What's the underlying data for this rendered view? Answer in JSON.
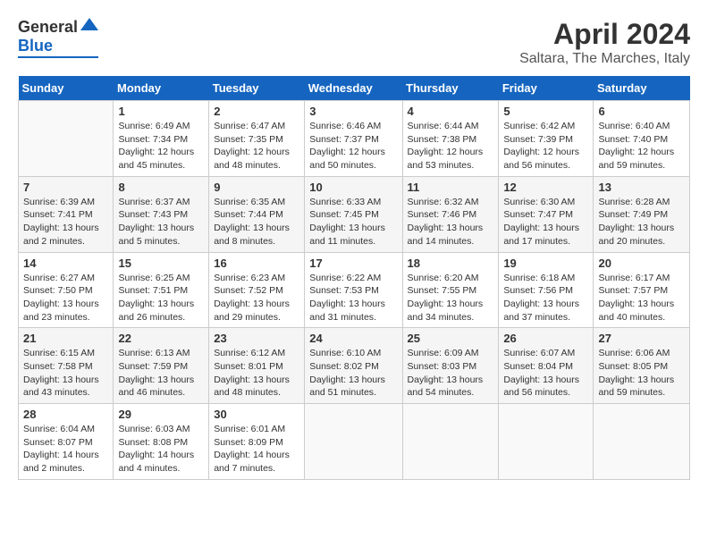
{
  "header": {
    "logo_general": "General",
    "logo_blue": "Blue",
    "title": "April 2024",
    "subtitle": "Saltara, The Marches, Italy"
  },
  "calendar": {
    "days_of_week": [
      "Sunday",
      "Monday",
      "Tuesday",
      "Wednesday",
      "Thursday",
      "Friday",
      "Saturday"
    ],
    "weeks": [
      [
        {
          "day": "",
          "info": ""
        },
        {
          "day": "1",
          "info": "Sunrise: 6:49 AM\nSunset: 7:34 PM\nDaylight: 12 hours\nand 45 minutes."
        },
        {
          "day": "2",
          "info": "Sunrise: 6:47 AM\nSunset: 7:35 PM\nDaylight: 12 hours\nand 48 minutes."
        },
        {
          "day": "3",
          "info": "Sunrise: 6:46 AM\nSunset: 7:37 PM\nDaylight: 12 hours\nand 50 minutes."
        },
        {
          "day": "4",
          "info": "Sunrise: 6:44 AM\nSunset: 7:38 PM\nDaylight: 12 hours\nand 53 minutes."
        },
        {
          "day": "5",
          "info": "Sunrise: 6:42 AM\nSunset: 7:39 PM\nDaylight: 12 hours\nand 56 minutes."
        },
        {
          "day": "6",
          "info": "Sunrise: 6:40 AM\nSunset: 7:40 PM\nDaylight: 12 hours\nand 59 minutes."
        }
      ],
      [
        {
          "day": "7",
          "info": "Sunrise: 6:39 AM\nSunset: 7:41 PM\nDaylight: 13 hours\nand 2 minutes."
        },
        {
          "day": "8",
          "info": "Sunrise: 6:37 AM\nSunset: 7:43 PM\nDaylight: 13 hours\nand 5 minutes."
        },
        {
          "day": "9",
          "info": "Sunrise: 6:35 AM\nSunset: 7:44 PM\nDaylight: 13 hours\nand 8 minutes."
        },
        {
          "day": "10",
          "info": "Sunrise: 6:33 AM\nSunset: 7:45 PM\nDaylight: 13 hours\nand 11 minutes."
        },
        {
          "day": "11",
          "info": "Sunrise: 6:32 AM\nSunset: 7:46 PM\nDaylight: 13 hours\nand 14 minutes."
        },
        {
          "day": "12",
          "info": "Sunrise: 6:30 AM\nSunset: 7:47 PM\nDaylight: 13 hours\nand 17 minutes."
        },
        {
          "day": "13",
          "info": "Sunrise: 6:28 AM\nSunset: 7:49 PM\nDaylight: 13 hours\nand 20 minutes."
        }
      ],
      [
        {
          "day": "14",
          "info": "Sunrise: 6:27 AM\nSunset: 7:50 PM\nDaylight: 13 hours\nand 23 minutes."
        },
        {
          "day": "15",
          "info": "Sunrise: 6:25 AM\nSunset: 7:51 PM\nDaylight: 13 hours\nand 26 minutes."
        },
        {
          "day": "16",
          "info": "Sunrise: 6:23 AM\nSunset: 7:52 PM\nDaylight: 13 hours\nand 29 minutes."
        },
        {
          "day": "17",
          "info": "Sunrise: 6:22 AM\nSunset: 7:53 PM\nDaylight: 13 hours\nand 31 minutes."
        },
        {
          "day": "18",
          "info": "Sunrise: 6:20 AM\nSunset: 7:55 PM\nDaylight: 13 hours\nand 34 minutes."
        },
        {
          "day": "19",
          "info": "Sunrise: 6:18 AM\nSunset: 7:56 PM\nDaylight: 13 hours\nand 37 minutes."
        },
        {
          "day": "20",
          "info": "Sunrise: 6:17 AM\nSunset: 7:57 PM\nDaylight: 13 hours\nand 40 minutes."
        }
      ],
      [
        {
          "day": "21",
          "info": "Sunrise: 6:15 AM\nSunset: 7:58 PM\nDaylight: 13 hours\nand 43 minutes."
        },
        {
          "day": "22",
          "info": "Sunrise: 6:13 AM\nSunset: 7:59 PM\nDaylight: 13 hours\nand 46 minutes."
        },
        {
          "day": "23",
          "info": "Sunrise: 6:12 AM\nSunset: 8:01 PM\nDaylight: 13 hours\nand 48 minutes."
        },
        {
          "day": "24",
          "info": "Sunrise: 6:10 AM\nSunset: 8:02 PM\nDaylight: 13 hours\nand 51 minutes."
        },
        {
          "day": "25",
          "info": "Sunrise: 6:09 AM\nSunset: 8:03 PM\nDaylight: 13 hours\nand 54 minutes."
        },
        {
          "day": "26",
          "info": "Sunrise: 6:07 AM\nSunset: 8:04 PM\nDaylight: 13 hours\nand 56 minutes."
        },
        {
          "day": "27",
          "info": "Sunrise: 6:06 AM\nSunset: 8:05 PM\nDaylight: 13 hours\nand 59 minutes."
        }
      ],
      [
        {
          "day": "28",
          "info": "Sunrise: 6:04 AM\nSunset: 8:07 PM\nDaylight: 14 hours\nand 2 minutes."
        },
        {
          "day": "29",
          "info": "Sunrise: 6:03 AM\nSunset: 8:08 PM\nDaylight: 14 hours\nand 4 minutes."
        },
        {
          "day": "30",
          "info": "Sunrise: 6:01 AM\nSunset: 8:09 PM\nDaylight: 14 hours\nand 7 minutes."
        },
        {
          "day": "",
          "info": ""
        },
        {
          "day": "",
          "info": ""
        },
        {
          "day": "",
          "info": ""
        },
        {
          "day": "",
          "info": ""
        }
      ]
    ]
  }
}
